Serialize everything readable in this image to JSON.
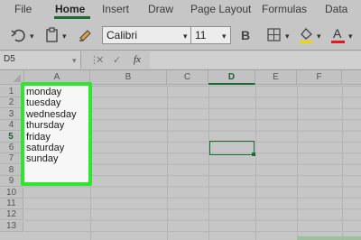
{
  "ribbon": {
    "tabs": [
      {
        "label": "File"
      },
      {
        "label": "Home"
      },
      {
        "label": "Insert"
      },
      {
        "label": "Draw"
      },
      {
        "label": "Page Layout"
      },
      {
        "label": "Formulas"
      },
      {
        "label": "Data"
      }
    ],
    "active_tab": "Home"
  },
  "toolbar": {
    "font_name": "Calibri",
    "font_size": "11",
    "bold_label": "B",
    "font_color_label": "A"
  },
  "formula_bar": {
    "name_box": "D5",
    "fx_label": "fx",
    "value": ""
  },
  "columns": [
    "A",
    "B",
    "C",
    "D",
    "E",
    "F"
  ],
  "selected_column": "D",
  "rows": [
    "1",
    "2",
    "3",
    "4",
    "5",
    "6",
    "7",
    "8",
    "9",
    "10",
    "11",
    "12",
    "13"
  ],
  "selected_row": "5",
  "cells": {
    "A": [
      "monday",
      "tuesday",
      "wednesday",
      "thursday",
      "friday",
      "saturday",
      "sunday"
    ]
  },
  "colors": {
    "accent": "#1e6b3a",
    "highlight_border": "#2ee62e",
    "fill_color_swatch": "#f2d600",
    "font_color_swatch": "#e0191f"
  }
}
